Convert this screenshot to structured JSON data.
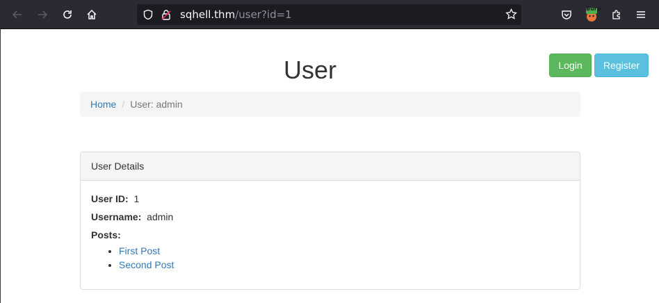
{
  "browser": {
    "url_host": "sqhell.thm",
    "url_path": "/user?id=1",
    "extension_badge": "Burp"
  },
  "header": {
    "title": "User",
    "login_label": "Login",
    "register_label": "Register"
  },
  "breadcrumb": {
    "home": "Home",
    "separator": "/",
    "current": "User: admin"
  },
  "panel": {
    "heading": "User Details",
    "user_id_label": "User ID:",
    "user_id_value": "1",
    "username_label": "Username:",
    "username_value": "admin",
    "posts_label": "Posts:",
    "posts": [
      "First Post",
      "Second Post"
    ]
  },
  "colors": {
    "login": "#5cb85c",
    "register": "#5bc0de",
    "link": "#337ab7"
  }
}
